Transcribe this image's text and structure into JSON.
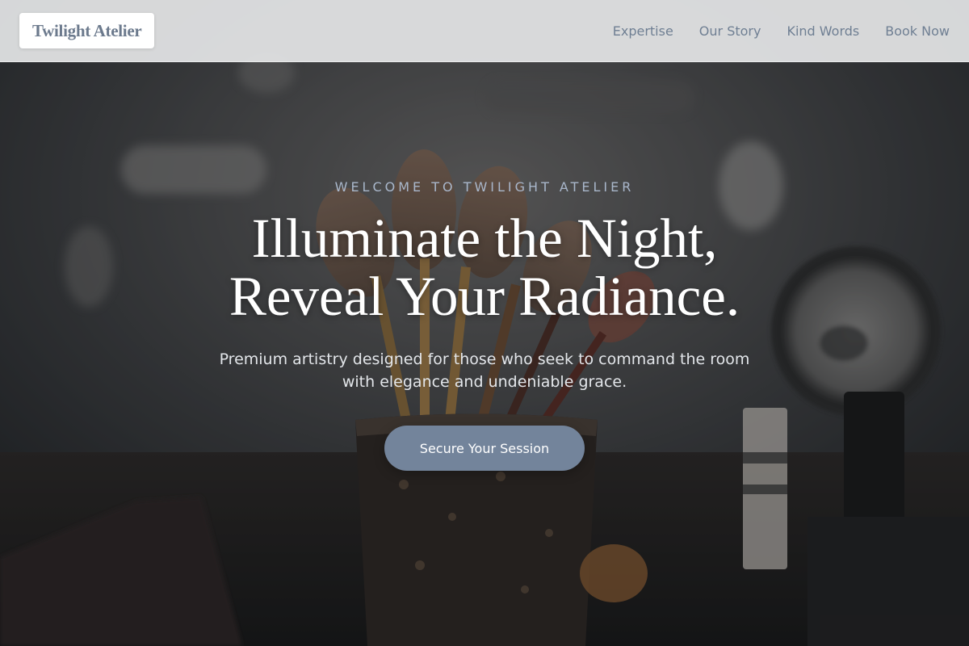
{
  "nav": {
    "brand": "Twilight Atelier",
    "links": [
      "Expertise",
      "Our Story",
      "Kind Words",
      "Book Now"
    ]
  },
  "hero": {
    "eyebrow": "WELCOME TO TWILIGHT ATELIER",
    "headline_line1": "Illuminate the Night,",
    "headline_line2": "Reveal Your Radiance.",
    "subtext": "Premium artistry designed for those who seek to command the room with elegance and undeniable grace.",
    "cta_label": "Secure Your Session",
    "background_image": "makeup-brushes-in-cup-with-round-mirror"
  },
  "colors": {
    "accent": "#73849b",
    "nav_text": "#6f7f93",
    "eyebrow": "#a9b7cb"
  }
}
